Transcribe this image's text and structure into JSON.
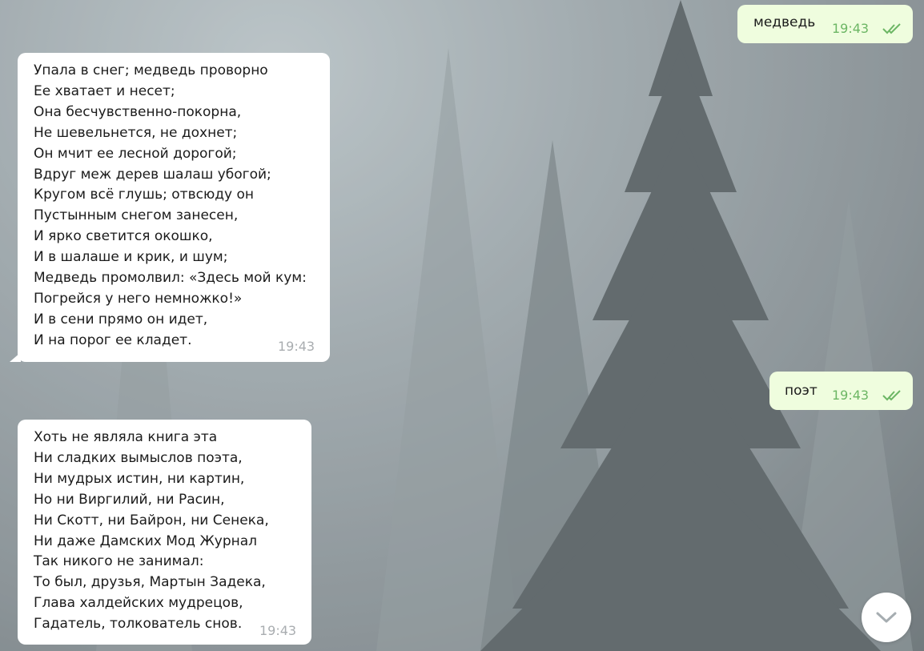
{
  "messages": [
    {
      "direction": "outgoing",
      "text": "медведь",
      "time": "19:43",
      "status": "read"
    },
    {
      "direction": "incoming",
      "lines": [
        "Упала в снег; медведь проворно",
        "Ее хватает и несет;",
        "Она бесчувственно-покорна,",
        "Не шевельнется, не дохнет;",
        "Он мчит ее лесной дорогой;",
        "Вдруг меж дерев шалаш убогой;",
        "Кругом всё глушь; отвсюду он",
        "Пустынным снегом занесен,",
        "И ярко светится окошко,",
        "И в шалаше и крик, и шум;",
        "Медведь промолвил: «Здесь мой кум:",
        "Погрейся у него немножко!»",
        "И в сени прямо он идет,",
        "И на порог ее кладет."
      ],
      "time": "19:43"
    },
    {
      "direction": "outgoing",
      "text": "поэт",
      "time": "19:43",
      "status": "read"
    },
    {
      "direction": "incoming",
      "lines": [
        "Хоть не являла книга эта",
        "Ни сладких вымыслов поэта,",
        "Ни мудрых истин, ни картин,",
        "Но ни Виргилий, ни Расин,",
        "Ни Скотт, ни Байрон, ни Сенека,",
        "Ни даже Дамских Мод Журнал",
        "Так никого не занимал:",
        "То был, друзья, Мартын Задека,",
        "Глава халдейских мудрецов,",
        "Гадатель, толкователь снов."
      ],
      "time": "19:43"
    }
  ],
  "scroll_button_icon": "chevron-down-icon",
  "colors": {
    "incoming_bubble": "#ffffff",
    "outgoing_bubble": "#effdde",
    "outgoing_time": "#6cb664",
    "incoming_time": "#a9adb0"
  }
}
